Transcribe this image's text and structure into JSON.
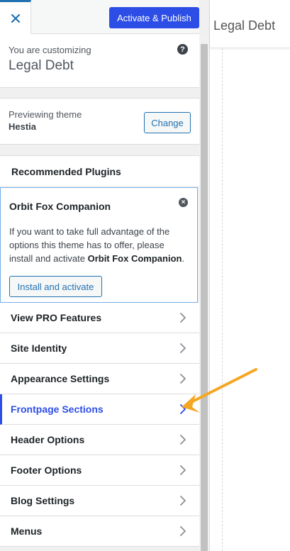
{
  "header": {
    "close_label": "Close",
    "publish_label": "Activate & Publish"
  },
  "customizing": {
    "label": "You are customizing",
    "site_name": "Legal Debt",
    "help_symbol": "?"
  },
  "theme": {
    "label": "Previewing theme",
    "name": "Hestia",
    "change_label": "Change"
  },
  "recommended": {
    "title": "Recommended Plugins",
    "plugin": {
      "title": "Orbit Fox Companion",
      "dismiss_symbol": "×",
      "desc_prefix": "If you want to take full advantage of the options this theme has to offer, please install and activate ",
      "desc_bold": "Orbit Fox Companion",
      "desc_suffix": ".",
      "install_label": "Install and activate"
    }
  },
  "menu": [
    {
      "label": "View PRO Features",
      "active": false
    },
    {
      "label": "Site Identity",
      "active": false
    },
    {
      "label": "Appearance Settings",
      "active": false
    },
    {
      "label": "Frontpage Sections",
      "active": true
    },
    {
      "label": "Header Options",
      "active": false
    },
    {
      "label": "Footer Options",
      "active": false
    },
    {
      "label": "Blog Settings",
      "active": false
    },
    {
      "label": "Menus",
      "active": false
    }
  ],
  "preview": {
    "site_title": "Legal Debt"
  },
  "colors": {
    "accent": "#2d4ee6",
    "link": "#2271b1",
    "annotation_arrow": "#f5a623"
  }
}
